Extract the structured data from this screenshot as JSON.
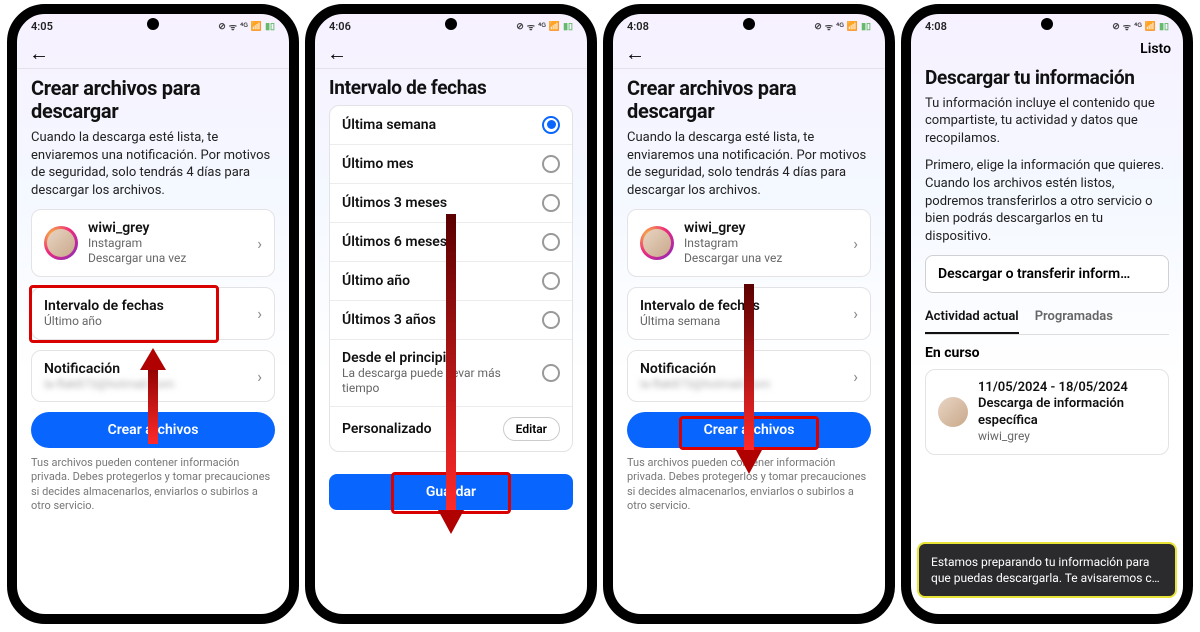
{
  "status": {
    "time1": "4:05",
    "time2": "4:06",
    "time3": "4:08",
    "time4": "4:08",
    "icons": "⊕ ⏦ 📶 🔋"
  },
  "s1": {
    "title": "Crear archivos para descargar",
    "desc": "Cuando la descarga esté lista, te enviaremos una notificación. Por motivos de seguridad, solo tendrás 4 días para descargar los archivos.",
    "user": {
      "name": "wiwi_grey",
      "platform": "Instagram",
      "action": "Descargar una vez"
    },
    "interval": {
      "label": "Intervalo de fechas",
      "value": "Último año"
    },
    "notif": {
      "label": "Notificación",
      "value": "la-flak873@hotmail.com"
    },
    "cta": "Crear archivos",
    "foot": "Tus archivos pueden contener información privada. Debes protegerlos y tomar precauciones si decides almacenarlos, enviarlos o subirlos a otro servicio."
  },
  "s2": {
    "title": "Intervalo de fechas",
    "options": [
      {
        "label": "Última semana",
        "selected": true
      },
      {
        "label": "Último mes",
        "selected": false
      },
      {
        "label": "Últimos 3 meses",
        "selected": false
      },
      {
        "label": "Últimos 6 meses",
        "selected": false
      },
      {
        "label": "Último año",
        "selected": false
      },
      {
        "label": "Últimos 3 años",
        "selected": false
      },
      {
        "label": "Desde el principio",
        "sub": "La descarga puede llevar más tiempo",
        "selected": false
      }
    ],
    "custom": {
      "label": "Personalizado",
      "edit": "Editar"
    },
    "cta": "Guardar"
  },
  "s3": {
    "interval_value": "Última semana"
  },
  "s4": {
    "done": "Listo",
    "title": "Descargar tu información",
    "p1": "Tu información incluye el contenido que compartiste, tu actividad y datos que recopilamos.",
    "p2": "Primero, elige la información que quieres. Cuando los archivos estén listos, podremos transferirlos a otro servicio o bien podrás descargarlos en tu dispositivo.",
    "chip": "Descargar o transferir inform…",
    "tabs": {
      "active": "Actividad actual",
      "other": "Programadas"
    },
    "section": "En curso",
    "item": {
      "title": "11/05/2024 - 18/05/2024 Descarga de información específica",
      "user": "wiwi_grey"
    },
    "toast": "Estamos preparando tu información para que puedas descargarla. Te avisaremos c…"
  }
}
